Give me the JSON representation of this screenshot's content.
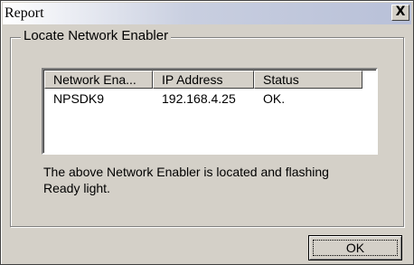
{
  "window": {
    "title": "Report",
    "close_glyph": "X"
  },
  "group": {
    "label": "Locate Network Enabler"
  },
  "list": {
    "columns": [
      "Network Ena...",
      "IP Address",
      "Status"
    ],
    "rows": [
      [
        "NPSDK9",
        "192.168.4.25",
        "OK."
      ]
    ]
  },
  "message": "The above Network Enabler is located and flashing Ready light.",
  "buttons": {
    "ok_label": "OK"
  }
}
